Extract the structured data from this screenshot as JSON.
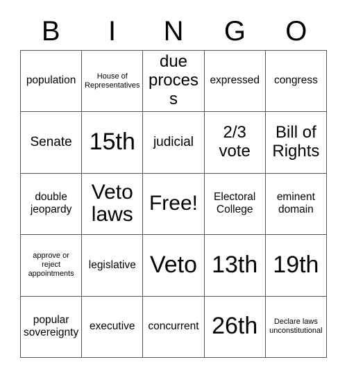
{
  "card": {
    "title": "BINGO",
    "header_letters": [
      "B",
      "I",
      "N",
      "G",
      "O"
    ],
    "rows": 5,
    "columns": 5,
    "colors": {
      "background": "#ffffff",
      "text": "#000000",
      "grid_line": "#555555"
    },
    "cells": [
      [
        {
          "text": "population",
          "size": "sm"
        },
        {
          "text": "House of Representatives",
          "size": "xs"
        },
        {
          "text": "due process",
          "size": "lg"
        },
        {
          "text": "expressed",
          "size": "sm"
        },
        {
          "text": "congress",
          "size": "sm"
        }
      ],
      [
        {
          "text": "Senate",
          "size": "md"
        },
        {
          "text": "15th",
          "size": "xxl"
        },
        {
          "text": "judicial",
          "size": "md"
        },
        {
          "text": "2/3 vote",
          "size": "lg"
        },
        {
          "text": "Bill of Rights",
          "size": "lg"
        }
      ],
      [
        {
          "text": "double jeopardy",
          "size": "sm"
        },
        {
          "text": "Veto laws",
          "size": "xl"
        },
        {
          "text": "Free!",
          "size": "xl"
        },
        {
          "text": "Electoral College",
          "size": "sm"
        },
        {
          "text": "eminent domain",
          "size": "sm"
        }
      ],
      [
        {
          "text": "approve or reject appointments",
          "size": "xs"
        },
        {
          "text": "legislative",
          "size": "sm"
        },
        {
          "text": "Veto",
          "size": "xxl"
        },
        {
          "text": "13th",
          "size": "xxl"
        },
        {
          "text": "19th",
          "size": "xxl"
        }
      ],
      [
        {
          "text": "popular sovereignty",
          "size": "sm"
        },
        {
          "text": "executive",
          "size": "sm"
        },
        {
          "text": "concurrent",
          "size": "sm"
        },
        {
          "text": "26th",
          "size": "xxl"
        },
        {
          "text": "Declare laws unconstitutional",
          "size": "xs"
        }
      ]
    ]
  }
}
